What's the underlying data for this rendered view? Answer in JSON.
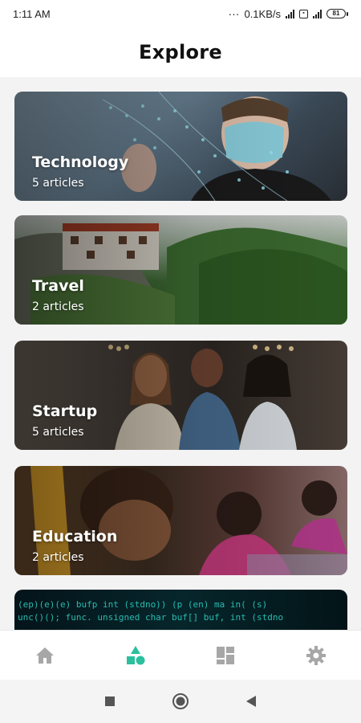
{
  "status_bar": {
    "time": "1:11 AM",
    "network_speed": "0.1KB/s",
    "battery": "81"
  },
  "header": {
    "title": "Explore"
  },
  "categories": [
    {
      "name": "Technology",
      "count": "5 articles"
    },
    {
      "name": "Travel",
      "count": "2 articles"
    },
    {
      "name": "Startup",
      "count": "5 articles"
    },
    {
      "name": "Education",
      "count": "2 articles"
    }
  ],
  "partial_card": {
    "code_lines": [
      "  (ep)(e)(e) bufp int (stdno)) (p (en) ma in( (s)",
      "unc()();      func. unsigned char buf[]    buf, int (stdno"
    ]
  },
  "bottom_nav": {
    "items": [
      {
        "icon": "home-icon",
        "active": false
      },
      {
        "icon": "explore-shapes-icon",
        "active": true
      },
      {
        "icon": "dashboard-icon",
        "active": false
      },
      {
        "icon": "settings-gear-icon",
        "active": false
      }
    ],
    "active_color": "#2bbf9e",
    "inactive_color": "#a7a7a7"
  },
  "system_nav": {
    "recents": "recents-square-icon",
    "home": "home-circle-icon",
    "back": "back-triangle-icon"
  }
}
